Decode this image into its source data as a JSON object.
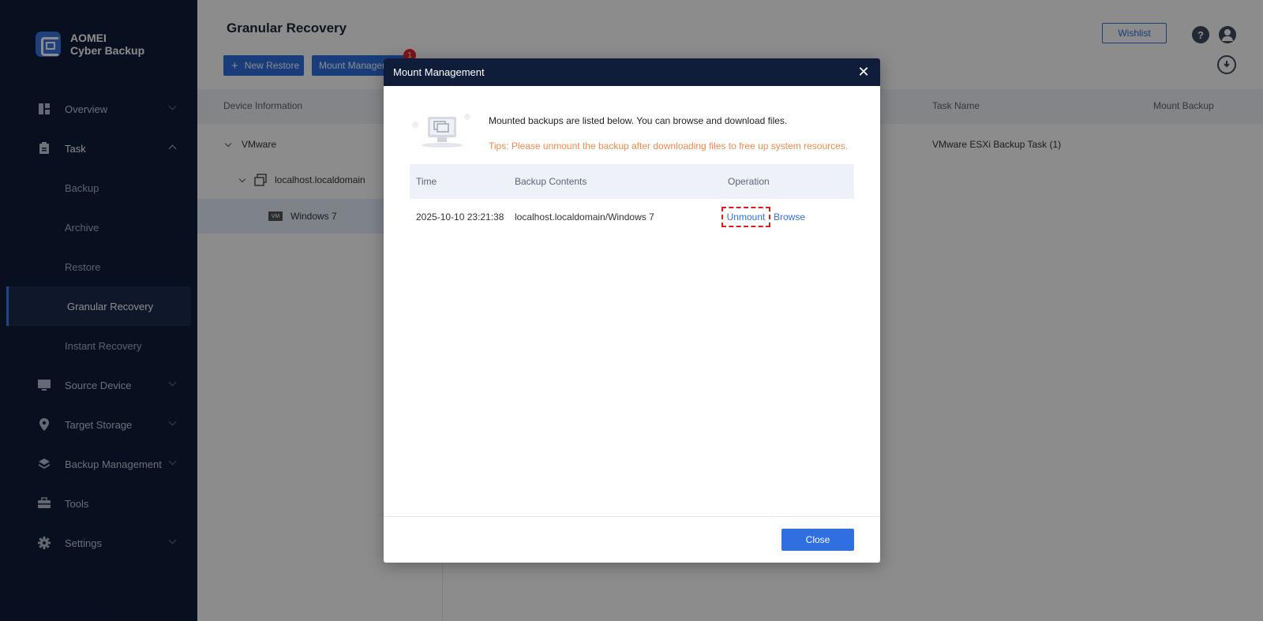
{
  "app": {
    "brand_line1": "AOMEI",
    "brand_line2": "Cyber Backup"
  },
  "sidebar": {
    "items": [
      {
        "label": "Overview",
        "icon": "dashboard-icon"
      },
      {
        "label": "Task",
        "icon": "clipboard-icon"
      },
      {
        "label": "Source Device",
        "icon": "monitor-icon"
      },
      {
        "label": "Target Storage",
        "icon": "location-pin-icon"
      },
      {
        "label": "Backup Management",
        "icon": "layers-icon"
      },
      {
        "label": "Tools",
        "icon": "toolbox-icon"
      },
      {
        "label": "Settings",
        "icon": "gear-icon"
      }
    ],
    "task_sub": [
      {
        "label": "Backup"
      },
      {
        "label": "Archive"
      },
      {
        "label": "Restore"
      },
      {
        "label": "Granular Recovery"
      },
      {
        "label": "Instant Recovery"
      }
    ]
  },
  "header": {
    "title": "Granular Recovery",
    "new_restore": "New Restore",
    "mount_management": "Mount Manager",
    "mount_badge": "1",
    "wishlist": "Wishlist",
    "help": "?"
  },
  "table": {
    "columns": [
      "Device Information",
      "Task Name",
      "Mount Backup"
    ],
    "tree": [
      {
        "label": "VMware"
      },
      {
        "label": "localhost.localdomain"
      },
      {
        "label": "Windows 7",
        "badge": "VM"
      }
    ],
    "task_name_value": "VMware ESXi Backup Task (1)"
  },
  "modal": {
    "title": "Mount Management",
    "info": "Mounted backups are listed below. You can browse and download files.",
    "tips": "Tips: Please unmount the backup after downloading files to free up system resources.",
    "columns": {
      "time": "Time",
      "contents": "Backup Contents",
      "operation": "Operation"
    },
    "rows": [
      {
        "time": "2025-10-10 23:21:38",
        "contents": "localhost.localdomain/Windows 7",
        "unmount": "Unmount",
        "browse": "Browse"
      }
    ],
    "close": "Close"
  },
  "colors": {
    "sidebar_bg": "#0f1c3a",
    "accent": "#2f6fe0",
    "tips": "#f08a4b",
    "highlight": "#e01b1b"
  }
}
